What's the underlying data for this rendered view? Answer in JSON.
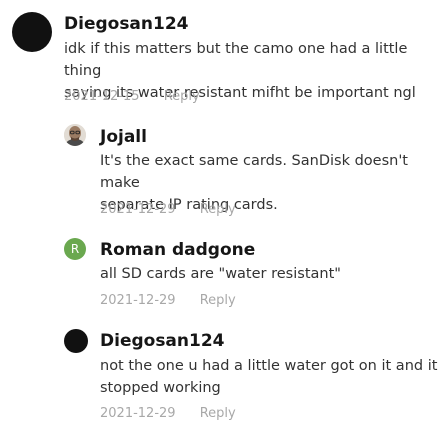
{
  "comments": [
    {
      "author": "Diegosan124",
      "text_line1": "idk if this matters but the camo one had a little thing",
      "text_line2": "saying its water resistant mifht be important ngl",
      "date": "2021-12-15",
      "reply_label": "Reply",
      "avatar_color": "#111111"
    },
    {
      "author": "Jojall",
      "text_line1": "It's the exact same cards. SanDisk doesn't make",
      "text_line2": "separate IP rating cards.",
      "date": "2021-12-29",
      "reply_label": "Reply",
      "avatar_type": "photo"
    },
    {
      "author": "Roman dadgone",
      "avatar_initial": "R",
      "text_line1": "all SD cards are \"water resistant\"",
      "date": "2021-12-29",
      "reply_label": "Reply",
      "avatar_color": "#6aa84f"
    },
    {
      "author": "Diegosan124",
      "text_line1": "not the one u had a little water got on it and it",
      "text_line2": "stopped working",
      "date": "2021-12-29",
      "reply_label": "Reply",
      "avatar_color": "#111111"
    }
  ]
}
